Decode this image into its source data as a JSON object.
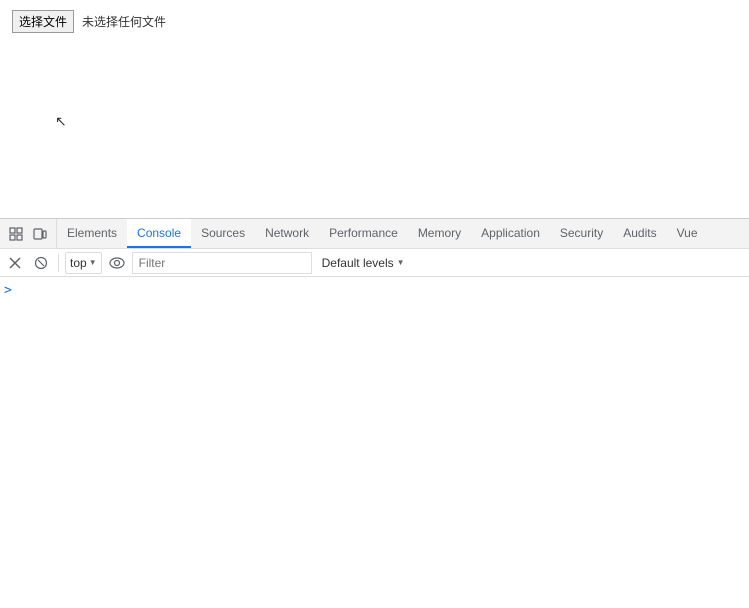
{
  "browser": {
    "file_button_label": "选择文件",
    "file_no_selected_label": "未选择任何文件"
  },
  "devtools": {
    "tabs": [
      {
        "id": "elements",
        "label": "Elements",
        "active": false
      },
      {
        "id": "console",
        "label": "Console",
        "active": true
      },
      {
        "id": "sources",
        "label": "Sources",
        "active": false
      },
      {
        "id": "network",
        "label": "Network",
        "active": false
      },
      {
        "id": "performance",
        "label": "Performance",
        "active": false
      },
      {
        "id": "memory",
        "label": "Memory",
        "active": false
      },
      {
        "id": "application",
        "label": "Application",
        "active": false
      },
      {
        "id": "security",
        "label": "Security",
        "active": false
      },
      {
        "id": "audits",
        "label": "Audits",
        "active": false
      },
      {
        "id": "vue",
        "label": "Vue",
        "active": false
      }
    ],
    "toolbar": {
      "context_label": "top",
      "filter_placeholder": "Filter",
      "default_levels_label": "Default levels"
    },
    "console_prompt": ">"
  }
}
